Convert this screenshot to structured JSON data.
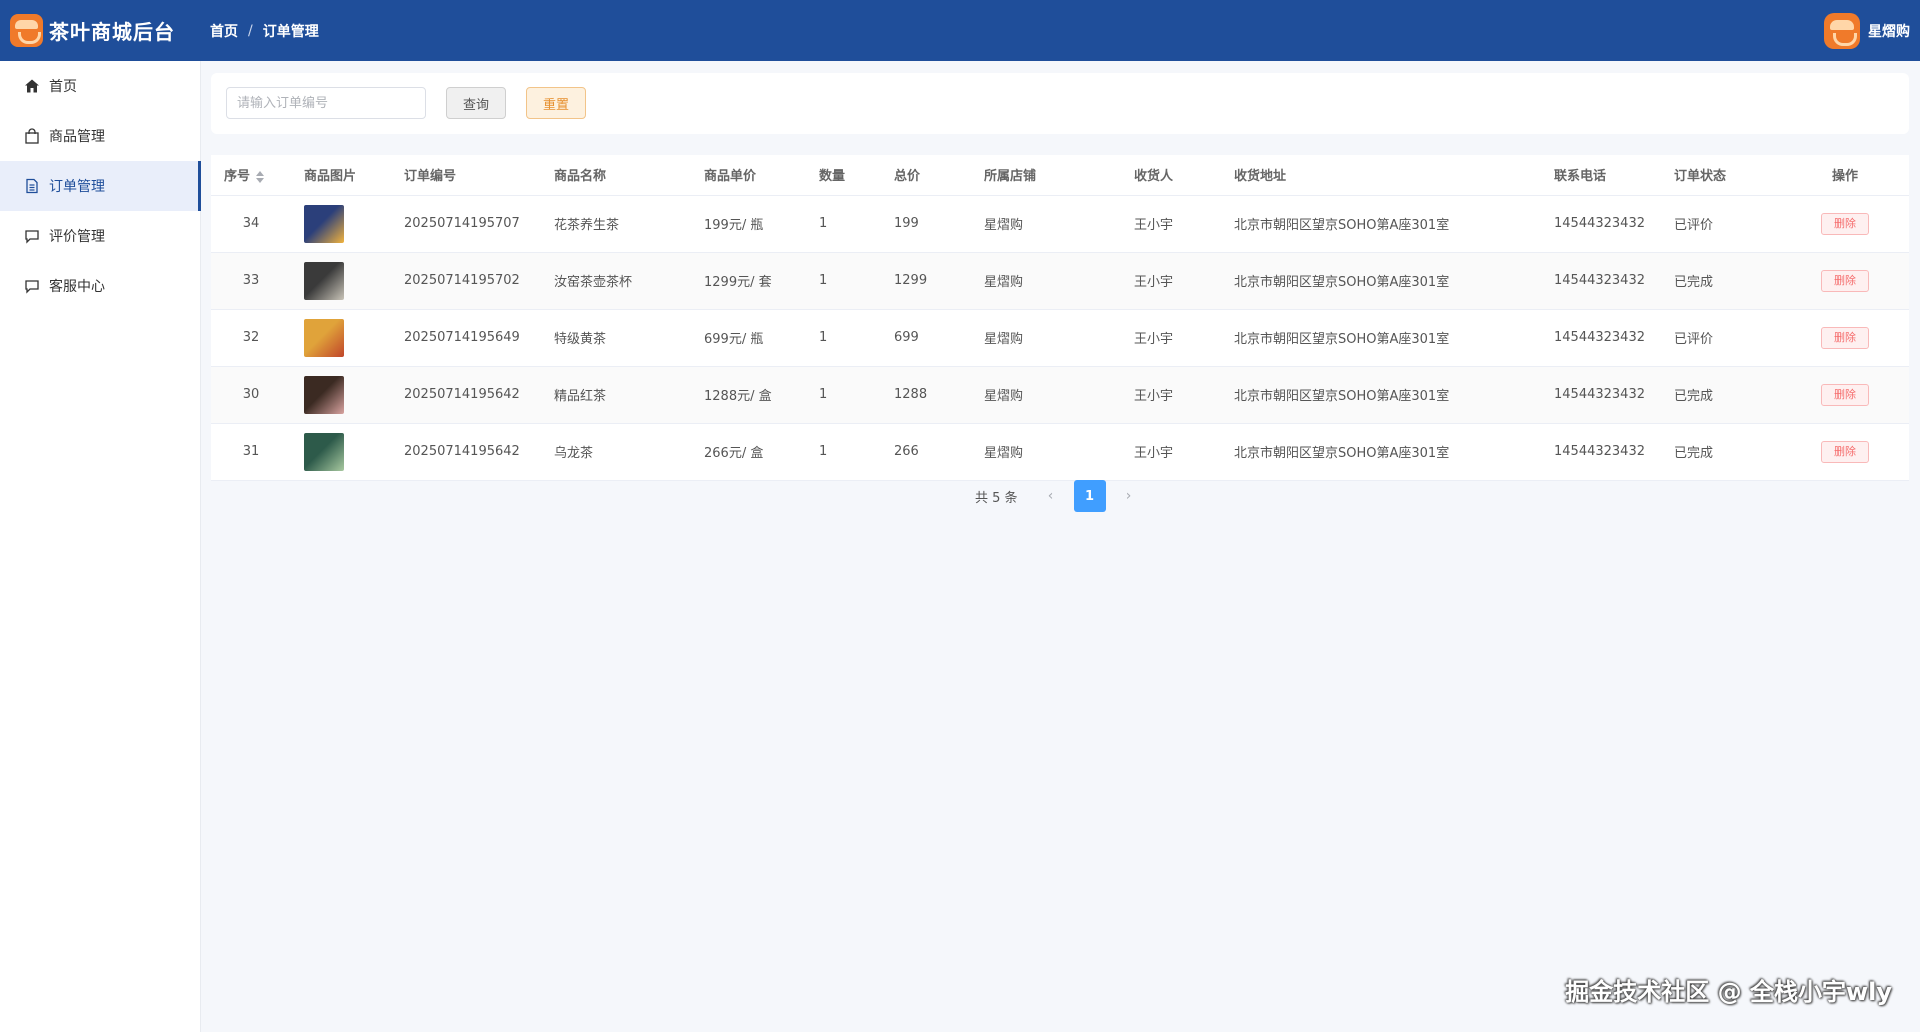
{
  "header": {
    "app_title": "茶叶商城后台",
    "breadcrumb": [
      "首页",
      "订单管理"
    ],
    "breadcrumb_sep": "/",
    "user_name": "星熠购"
  },
  "sidebar": {
    "items": [
      {
        "label": "首页",
        "icon": "home-icon"
      },
      {
        "label": "商品管理",
        "icon": "bag-icon"
      },
      {
        "label": "订单管理",
        "icon": "document-icon",
        "active": true
      },
      {
        "label": "评价管理",
        "icon": "comment-icon"
      },
      {
        "label": "客服中心",
        "icon": "chat-icon"
      }
    ]
  },
  "search": {
    "placeholder": "请输入订单编号",
    "value": "",
    "query_label": "查询",
    "reset_label": "重置"
  },
  "table": {
    "columns": [
      "序号",
      "商品图片",
      "订单编号",
      "商品名称",
      "商品单价",
      "数量",
      "总价",
      "所属店铺",
      "收货人",
      "收货地址",
      "联系电话",
      "订单状态",
      "操作"
    ],
    "rows": [
      {
        "id": "34",
        "order_no": "20250714195707",
        "name": "花茶养生茶",
        "price": "199元/ 瓶",
        "qty": "1",
        "total": "199",
        "shop": "星熠购",
        "receiver": "王小宇",
        "address": "北京市朝阳区望京SOHO第A座301室",
        "phone": "14544323432",
        "status": "已评价",
        "action": "删除",
        "thumb_colors": [
          "#2b3f7a",
          "#f2b33d"
        ]
      },
      {
        "id": "33",
        "order_no": "20250714195702",
        "name": "汝窑茶壶茶杯",
        "price": "1299元/ 套",
        "qty": "1",
        "total": "1299",
        "shop": "星熠购",
        "receiver": "王小宇",
        "address": "北京市朝阳区望京SOHO第A座301室",
        "phone": "14544323432",
        "status": "已完成",
        "action": "删除",
        "thumb_colors": [
          "#3a3a3a",
          "#c9c4b8"
        ]
      },
      {
        "id": "32",
        "order_no": "20250714195649",
        "name": "特级黄茶",
        "price": "699元/ 瓶",
        "qty": "1",
        "total": "699",
        "shop": "星熠购",
        "receiver": "王小宇",
        "address": "北京市朝阳区望京SOHO第A座301室",
        "phone": "14544323432",
        "status": "已评价",
        "action": "删除",
        "thumb_colors": [
          "#e0a33a",
          "#c0452a"
        ]
      },
      {
        "id": "30",
        "order_no": "20250714195642",
        "name": "精品红茶",
        "price": "1288元/ 盒",
        "qty": "1",
        "total": "1288",
        "shop": "星熠购",
        "receiver": "王小宇",
        "address": "北京市朝阳区望京SOHO第A座301室",
        "phone": "14544323432",
        "status": "已完成",
        "action": "删除",
        "thumb_colors": [
          "#3b2a22",
          "#d9a3a0"
        ]
      },
      {
        "id": "31",
        "order_no": "20250714195642",
        "name": "乌龙茶",
        "price": "266元/ 盒",
        "qty": "1",
        "total": "266",
        "shop": "星熠购",
        "receiver": "王小宇",
        "address": "北京市朝阳区望京SOHO第A座301室",
        "phone": "14544323432",
        "status": "已完成",
        "action": "删除",
        "thumb_colors": [
          "#2d5a4a",
          "#a8c9a0"
        ]
      }
    ]
  },
  "pagination": {
    "total_text": "共 5 条",
    "prev": "‹",
    "current": "1",
    "next": "›"
  },
  "watermark": "掘金技术社区 @ 全栈小宇wly",
  "colors": {
    "header_bg": "#1f4e9a",
    "accent": "#409eff",
    "delete": "#f56c6c",
    "reset": "#e6902f"
  }
}
